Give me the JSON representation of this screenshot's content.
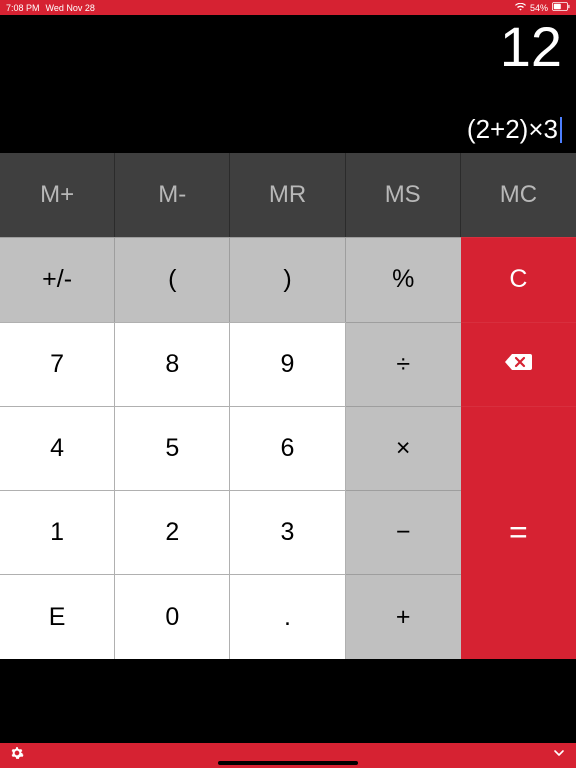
{
  "status": {
    "time": "7:08 PM",
    "date": "Wed Nov 28",
    "battery": "54%"
  },
  "display": {
    "result": "12",
    "expression": "(2+2)×3"
  },
  "mem": {
    "mplus": "M+",
    "mminus": "M-",
    "mr": "MR",
    "ms": "MS",
    "mc": "MC"
  },
  "keys": {
    "sign": "+/-",
    "lp": "(",
    "rp": ")",
    "pct": "%",
    "clear": "C",
    "n7": "7",
    "n8": "8",
    "n9": "9",
    "div": "÷",
    "n4": "4",
    "n5": "5",
    "n6": "6",
    "mul": "×",
    "n1": "1",
    "n2": "2",
    "n3": "3",
    "sub": "−",
    "eq": "=",
    "e": "E",
    "n0": "0",
    "dot": ".",
    "add": "+"
  }
}
